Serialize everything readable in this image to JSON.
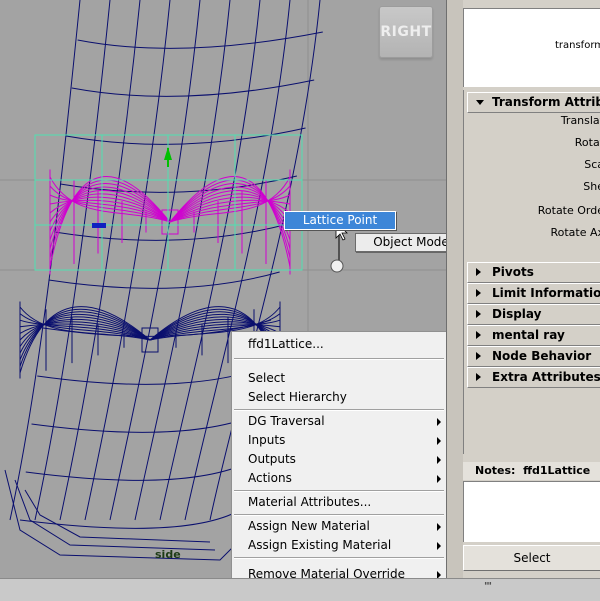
{
  "viewport": {
    "view_cube_label": "RIGHT",
    "camera_label": "side",
    "colors": {
      "background": "#a3a3a3",
      "mesh": "#0a0f6e",
      "lattice_selected": "#d000d0",
      "lattice_box": "#4fe0b0",
      "manipulator": "#00c000"
    }
  },
  "marking_menu": {
    "north_item": "Lattice Point",
    "east_item": "Object Mode"
  },
  "context_menu": {
    "header": "ffd1Lattice...",
    "items_a": [
      "Select",
      "Select Hierarchy"
    ],
    "items_b": [
      "DG Traversal",
      "Inputs",
      "Outputs",
      "Actions"
    ],
    "items_c": [
      "Material Attributes..."
    ],
    "items_d": [
      "Assign New Material",
      "Assign Existing Material"
    ],
    "items_e": [
      "Remove Material Override"
    ]
  },
  "attribute_editor": {
    "transform_label": "transform",
    "transform_section": "Transform Attributes",
    "transform_rows": [
      "Translat",
      "Rotat",
      "Sca",
      "She",
      "Rotate Orde",
      "Rotate Ax"
    ],
    "sections": [
      "Pivots",
      "Limit Information",
      "Display",
      "mental ray",
      "Node Behavior",
      "Extra Attributes"
    ],
    "notes_label": "Notes:",
    "notes_node": "ffd1Lattice",
    "select_button": "Select"
  },
  "bottom_bar": {
    "grip": "''''"
  }
}
